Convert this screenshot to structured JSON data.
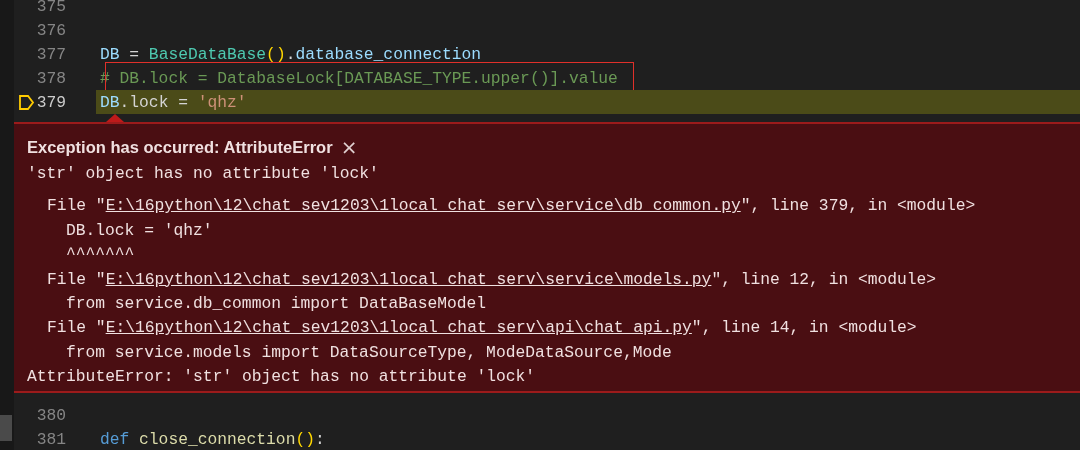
{
  "editor": {
    "lines_before": [
      {
        "number": "375"
      },
      {
        "number": "376"
      },
      {
        "number": "377",
        "tokens": [
          {
            "kind": "variable",
            "text": "DB"
          },
          {
            "kind": "plain",
            "text": " = "
          },
          {
            "kind": "class",
            "text": "BaseDataBase"
          },
          {
            "kind": "bracket",
            "text": "()"
          },
          {
            "kind": "plain",
            "text": "."
          },
          {
            "kind": "variable",
            "text": "database_connection"
          }
        ]
      },
      {
        "number": "378",
        "annotated": true,
        "tokens": [
          {
            "kind": "comment",
            "text": "# DB.lock = DatabaseLock[DATABASE_TYPE.upper()].value"
          }
        ]
      },
      {
        "number": "379",
        "current": true,
        "tokens": [
          {
            "kind": "variable",
            "text": "DB"
          },
          {
            "kind": "plain",
            "text": ".lock = "
          },
          {
            "kind": "string",
            "text": "'qhz'"
          }
        ]
      }
    ],
    "exception": {
      "title": "Exception has occurred: AttributeError",
      "close": "×",
      "message": "'str' object has no attribute 'lock'",
      "trace": [
        {
          "kind": "file",
          "prefix": "File \"",
          "link": "E:\\16python\\12\\chat_sev1203\\1local_chat_serv\\service\\db_common.py",
          "suffix": "\", line 379, in <module>"
        },
        {
          "kind": "code",
          "text": "DB.lock = 'qhz'"
        },
        {
          "kind": "code",
          "text": "^^^^^^^"
        },
        {
          "kind": "file",
          "prefix": "File \"",
          "link": "E:\\16python\\12\\chat_sev1203\\1local_chat_serv\\service\\models.py",
          "suffix": "\", line 12, in <module>"
        },
        {
          "kind": "code",
          "text": "from service.db_common import DataBaseModel"
        },
        {
          "kind": "file",
          "prefix": "File \"",
          "link": "E:\\16python\\12\\chat_sev1203\\1local_chat_serv\\api\\chat_api.py",
          "suffix": "\", line 14, in <module>"
        },
        {
          "kind": "code",
          "text": "from service.models import DataSourceType, ModeDataSource,Mode"
        }
      ],
      "error": "AttributeError: 'str' object has no attribute 'lock'"
    },
    "lines_after": [
      {
        "number": "380"
      },
      {
        "number": "381",
        "tokens": [
          {
            "kind": "keyword",
            "text": "def"
          },
          {
            "kind": "function",
            "text": " close_connection"
          },
          {
            "kind": "bracket",
            "text": "()"
          },
          {
            "kind": "plain",
            "text": ":"
          }
        ]
      }
    ]
  }
}
